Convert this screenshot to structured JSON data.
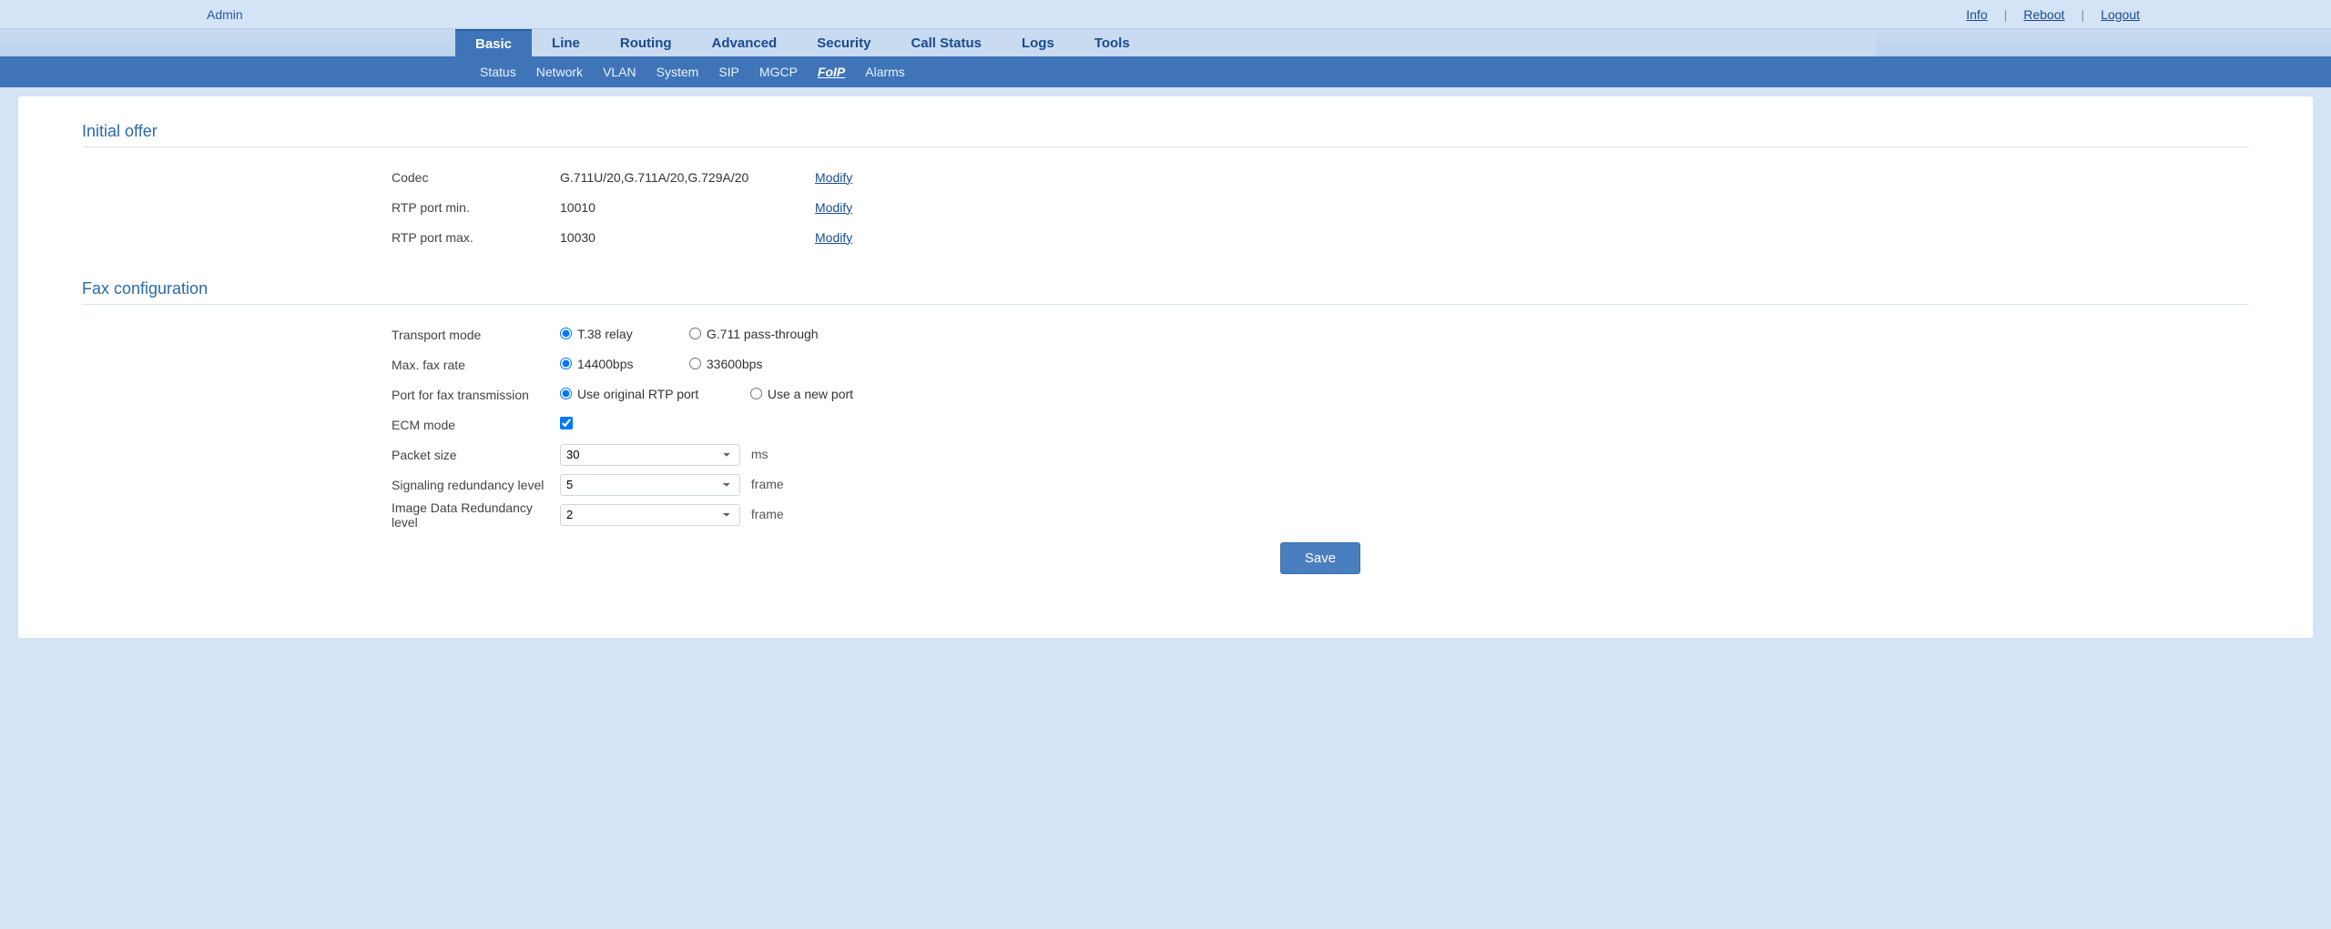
{
  "topbar": {
    "admin": "Admin",
    "info": "Info",
    "reboot": "Reboot",
    "logout": "Logout"
  },
  "mainnav": {
    "basic": "Basic",
    "line": "Line",
    "routing": "Routing",
    "advanced": "Advanced",
    "security": "Security",
    "callstatus": "Call Status",
    "logs": "Logs",
    "tools": "Tools"
  },
  "subnav": {
    "status": "Status",
    "network": "Network",
    "vlan": "VLAN",
    "system": "System",
    "sip": "SIP",
    "mgcp": "MGCP",
    "foip": "FoIP",
    "alarms": "Alarms"
  },
  "sections": {
    "initial_offer": "Initial offer",
    "fax_configuration": "Fax configuration"
  },
  "initial_offer": {
    "codec_label": "Codec",
    "codec_value": "G.711U/20,G.711A/20,G.729A/20",
    "codec_modify": "Modify",
    "rtp_min_label": "RTP port min.",
    "rtp_min_value": "10010",
    "rtp_min_modify": "Modify",
    "rtp_max_label": "RTP port max.",
    "rtp_max_value": "10030",
    "rtp_max_modify": "Modify"
  },
  "fax": {
    "transport_label": "Transport mode",
    "transport_t38": "T.38 relay",
    "transport_g711": "G.711 pass-through",
    "maxrate_label": "Max. fax rate",
    "maxrate_14400": "14400bps",
    "maxrate_33600": "33600bps",
    "port_label": "Port for fax transmission",
    "port_orig": "Use original RTP port",
    "port_new": "Use a new port",
    "ecm_label": "ECM mode",
    "packet_label": "Packet size",
    "packet_value": "30",
    "packet_suffix": "ms",
    "sig_label": "Signaling redundancy level",
    "sig_value": "5",
    "sig_suffix": "frame",
    "img_label": "Image Data Redundancy level",
    "img_value": "2",
    "img_suffix": "frame"
  },
  "buttons": {
    "save": "Save"
  }
}
